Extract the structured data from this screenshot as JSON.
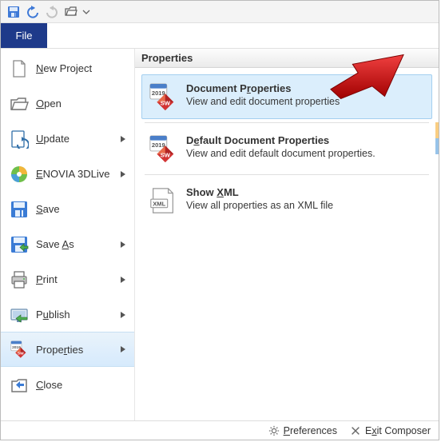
{
  "file_tab": {
    "label": "File"
  },
  "left_menu": {
    "items": [
      {
        "label_pre": "",
        "u": "N",
        "label_post": "ew Project",
        "has_sub": false,
        "icon": "doc"
      },
      {
        "label_pre": "",
        "u": "O",
        "label_post": "pen",
        "has_sub": false,
        "icon": "open"
      },
      {
        "label_pre": "",
        "u": "U",
        "label_post": "pdate",
        "has_sub": true,
        "icon": "update"
      },
      {
        "label_pre": "",
        "u": "E",
        "label_post": "NOVIA 3DLive",
        "has_sub": true,
        "icon": "ball"
      },
      {
        "label_pre": "",
        "u": "S",
        "label_post": "ave",
        "has_sub": false,
        "icon": "save"
      },
      {
        "label_pre": "Save ",
        "u": "A",
        "label_post": "s",
        "has_sub": true,
        "icon": "saveas"
      },
      {
        "label_pre": "",
        "u": "P",
        "label_post": "rint",
        "has_sub": true,
        "icon": "print"
      },
      {
        "label_pre": "P",
        "u": "u",
        "label_post": "blish",
        "has_sub": true,
        "icon": "publish"
      },
      {
        "label_pre": "Prope",
        "u": "r",
        "label_post": "ties",
        "has_sub": true,
        "icon": "sw",
        "selected": true
      },
      {
        "label_pre": "",
        "u": "C",
        "label_post": "lose",
        "has_sub": false,
        "icon": "close"
      }
    ]
  },
  "right_panel": {
    "header": "Properties",
    "items": [
      {
        "title_pre": "Document P",
        "u": "r",
        "title_post": "operties",
        "desc": "View and edit document properties",
        "icon": "sw",
        "hover": true
      },
      {
        "title_pre": "D",
        "u": "e",
        "title_post": "fault Document Properties",
        "desc": "View and edit default document properties.",
        "icon": "sw"
      },
      {
        "title_pre": "Show ",
        "u": "X",
        "title_post": "ML",
        "desc": "View all properties as an XML file",
        "icon": "xml"
      }
    ]
  },
  "statusbar": {
    "prefs_pre": "",
    "prefs_u": "P",
    "prefs_post": "references",
    "exit_pre": "E",
    "exit_u": "x",
    "exit_post": "it Composer"
  }
}
